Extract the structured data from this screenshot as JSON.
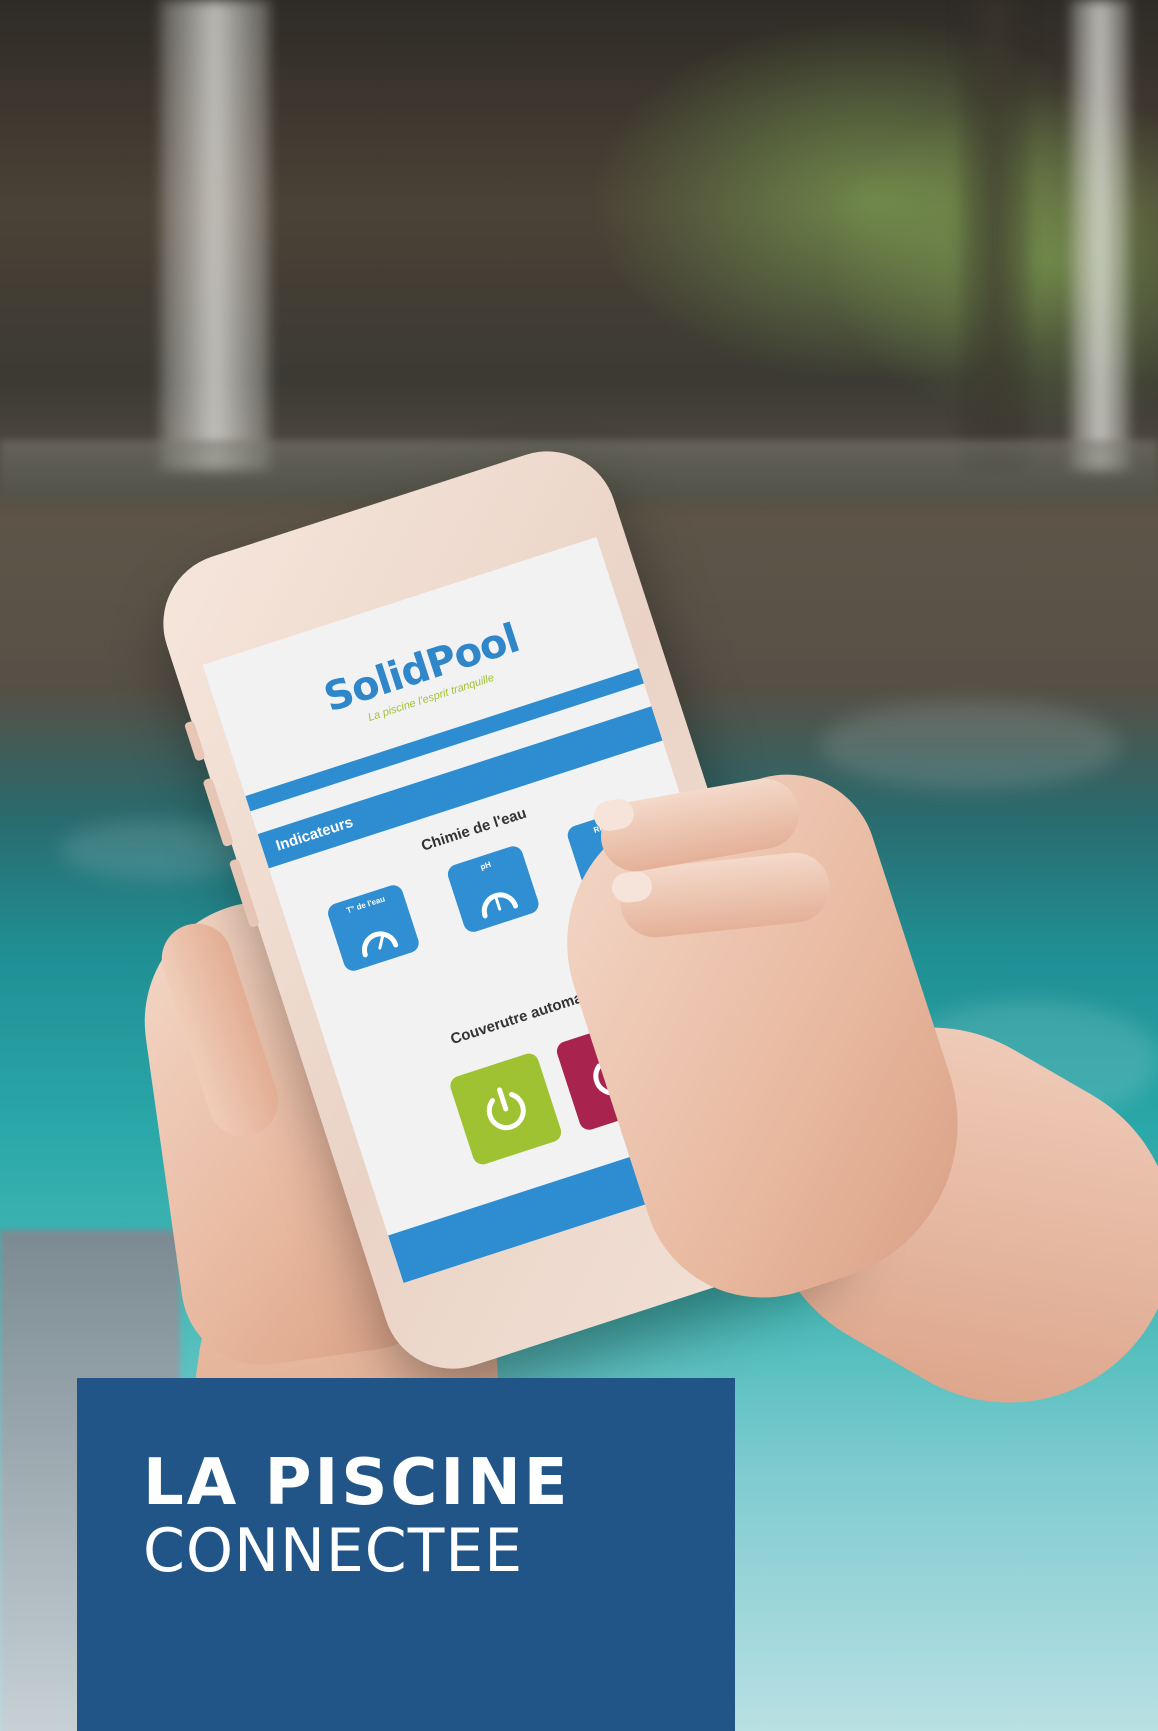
{
  "app": {
    "brand": "SolidPool",
    "tagline": "La piscine l'esprit tranquille",
    "section_title": "Indicateurs",
    "chemistry_title": "Chimie de l'eau",
    "indicators": [
      {
        "label": "T° de l'eau",
        "icon": "gauge-icon"
      },
      {
        "label": "pH",
        "icon": "gauge-icon"
      },
      {
        "label": "Redox",
        "icon": "gauge-icon"
      }
    ],
    "cover_title": "Couverutre automatique",
    "cover_buttons": [
      {
        "state": "on",
        "icon": "power-icon",
        "color": "#9ec232"
      },
      {
        "state": "off",
        "icon": "power-icon",
        "color": "#a8244f"
      }
    ],
    "accent_color": "#2d8dd0"
  },
  "caption": {
    "line1": "LA PISCINE",
    "line2": "CONNECTEE",
    "background_color": "#225587"
  }
}
